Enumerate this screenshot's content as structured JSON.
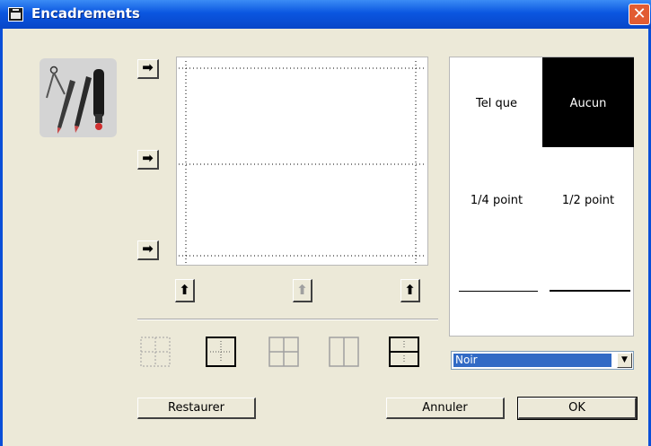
{
  "window": {
    "title": "Encadrements",
    "close_label": "✕"
  },
  "arrows": {
    "right": "➡",
    "up": "⬆"
  },
  "border_styles": [
    "Tel que",
    "Aucun",
    "1/4 point",
    "1/2 point"
  ],
  "color_select": {
    "selected": "Noir"
  },
  "buttons": {
    "restore": "Restaurer",
    "cancel": "Annuler",
    "ok": "OK"
  },
  "icons": {
    "tools": "drawing-tools-icon",
    "border_presets": [
      "no-border-icon",
      "outside-border-icon",
      "grid-border-icon",
      "vertical-split-border-icon",
      "horizontal-split-border-icon"
    ]
  },
  "colors": {
    "titlebar": "#0a56e0",
    "selection": "#316ac5",
    "dialog_bg": "#ece9d8"
  }
}
